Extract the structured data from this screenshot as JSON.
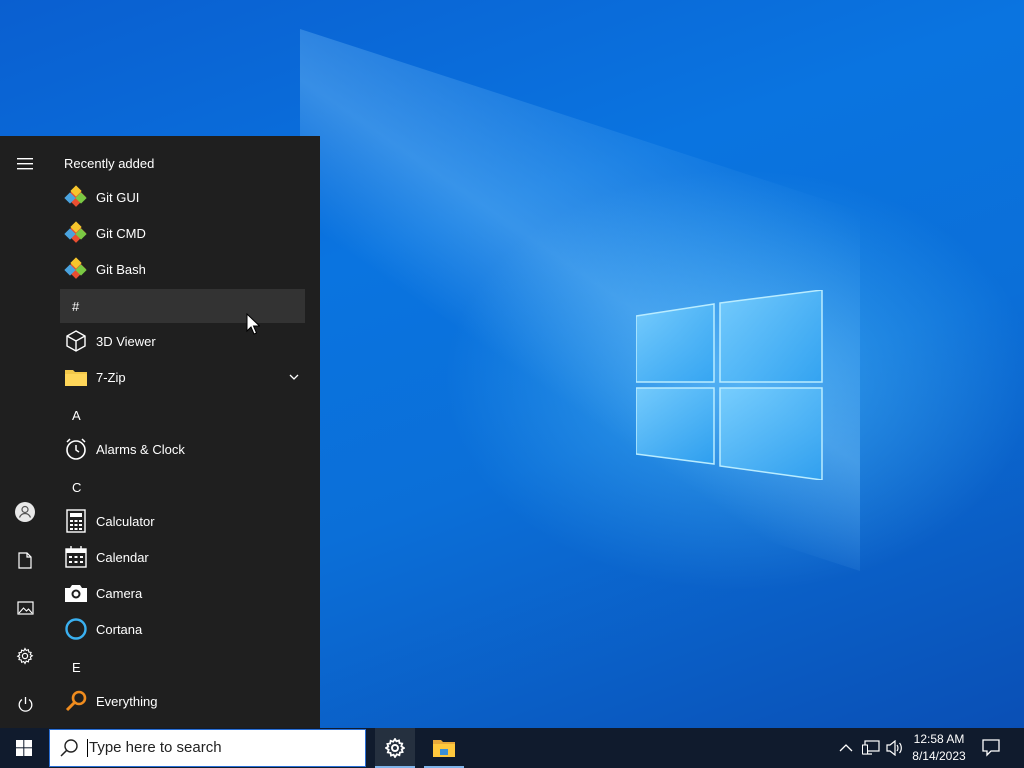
{
  "start_menu": {
    "recently_added_header": "Recently added",
    "recent_apps": [
      {
        "label": "Git GUI",
        "icon": "git-icon"
      },
      {
        "label": "Git CMD",
        "icon": "git-icon"
      },
      {
        "label": "Git Bash",
        "icon": "git-icon"
      }
    ],
    "groups": [
      {
        "letter": "#",
        "apps": [
          {
            "label": "3D Viewer",
            "icon": "cube-icon"
          },
          {
            "label": "7-Zip",
            "icon": "folder-icon",
            "expandable": true
          }
        ]
      },
      {
        "letter": "A",
        "apps": [
          {
            "label": "Alarms & Clock",
            "icon": "clock-icon"
          }
        ]
      },
      {
        "letter": "C",
        "apps": [
          {
            "label": "Calculator",
            "icon": "calculator-icon"
          },
          {
            "label": "Calendar",
            "icon": "calendar-icon"
          },
          {
            "label": "Camera",
            "icon": "camera-icon"
          },
          {
            "label": "Cortana",
            "icon": "cortana-icon"
          }
        ]
      },
      {
        "letter": "E",
        "apps": [
          {
            "label": "Everything",
            "icon": "search-magnifier-icon"
          }
        ]
      }
    ],
    "rail": [
      "hamburger-menu-icon",
      "user-icon",
      "document-icon",
      "pictures-icon",
      "gear-icon",
      "power-icon"
    ]
  },
  "taskbar": {
    "search_placeholder": "Type here to search",
    "clock_time": "12:58 AM",
    "clock_date": "8/14/2023",
    "pinned": [
      "settings-gear-icon",
      "file-explorer-icon"
    ],
    "tray": [
      "chevron-up-icon",
      "network-icon",
      "volume-icon"
    ]
  },
  "colors": {
    "start_bg": "#1f1f1f",
    "taskbar_bg": "#101b2d",
    "desktop_blue": "#0a6fd8",
    "accent": "#2a6fd6"
  }
}
